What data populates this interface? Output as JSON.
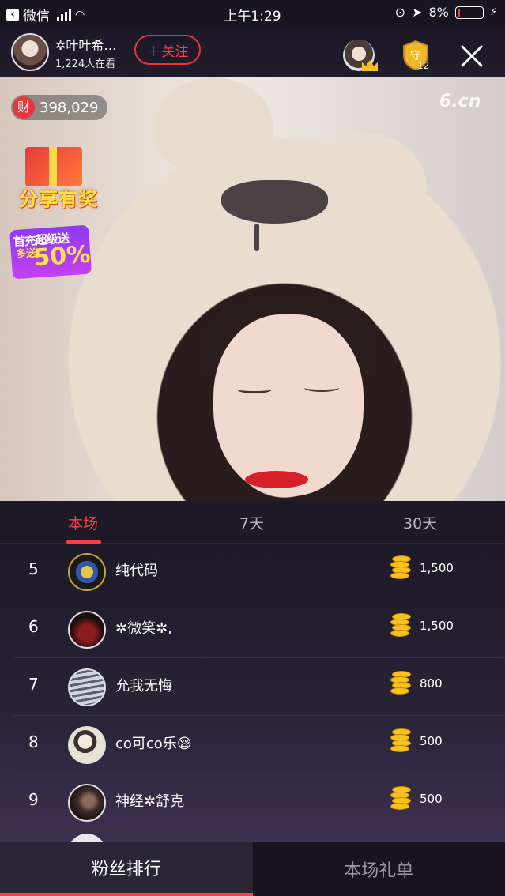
{
  "status_bar": {
    "back_app": "微信",
    "time": "上午1:29",
    "battery": "8%"
  },
  "header": {
    "host_name": "✲叶叶希…",
    "viewer_count": "1,224人在看",
    "follow_label": "关注",
    "guard_count": "12"
  },
  "video": {
    "wealth_icon": "财",
    "wealth_value": "398,029",
    "watermark": "6.cn",
    "share_label": "分享有奖",
    "promo_top": "首充超级送",
    "promo_left": "多送",
    "promo_big": "50%"
  },
  "tabs": {
    "items": [
      "本场",
      "7天",
      "30天"
    ],
    "active": "本场"
  },
  "ranking": {
    "rows": [
      {
        "rank": "5",
        "name": "纯代码",
        "amount": "1,500"
      },
      {
        "rank": "6",
        "name": "✲微笑✲,",
        "amount": "1,500"
      },
      {
        "rank": "7",
        "name": "允我无悔",
        "amount": "800"
      },
      {
        "rank": "8",
        "name": "co可co乐😪",
        "amount": "500"
      },
      {
        "rank": "9",
        "name": "神经✲舒克",
        "amount": "500"
      }
    ]
  },
  "bottom_tabs": {
    "fans": "粉丝排行",
    "gifts": "本场礼单"
  },
  "colors": {
    "accent": "#ff3e42",
    "coin": "#f7c21f",
    "background": "#1b1725"
  }
}
